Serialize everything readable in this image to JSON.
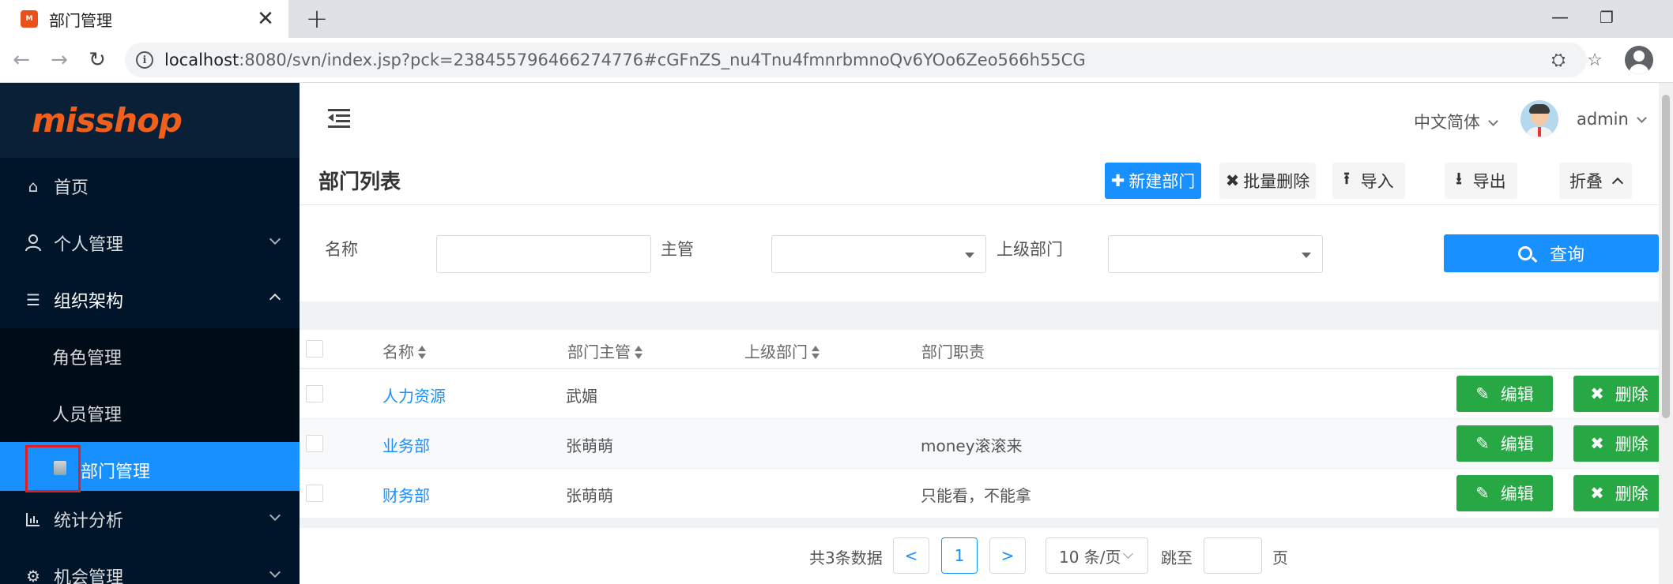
{
  "browser": {
    "tab_title": "部门管理",
    "favicon_label": "misshop",
    "close_glyph": "✕",
    "newtab_glyph": "+",
    "url_host": "localhost",
    "url_rest": ":8080/svn/index.jsp?pck=238455796466274776#cGFnZS_nu4Tnu4fmnrbmnoQv6YOo6Zeo566h55CG",
    "minimize_glyph": "—",
    "restore_glyph": "❐"
  },
  "sidebar": {
    "logo": "misshop",
    "items": [
      {
        "label": "首页",
        "icon": "home-icon"
      },
      {
        "label": "个人管理",
        "icon": "user-icon"
      },
      {
        "label": "组织架构",
        "icon": "menu-icon"
      },
      {
        "label": "统计分析",
        "icon": "bar-chart-icon"
      },
      {
        "label": "机会管理",
        "icon": "gear-icon"
      }
    ],
    "submenu": [
      {
        "label": "角色管理"
      },
      {
        "label": "人员管理"
      },
      {
        "label": "部门管理"
      }
    ]
  },
  "header": {
    "language": "中文简体",
    "username": "admin"
  },
  "panel": {
    "title": "部门列表",
    "buttons": {
      "new": "新建部门",
      "batch_delete": "批量删除",
      "import": "导入",
      "export": "导出",
      "fold": "折叠"
    }
  },
  "search": {
    "name_label": "名称",
    "manager_label": "主管",
    "parent_label": "上级部门",
    "button": "查询"
  },
  "table": {
    "columns": [
      "名称",
      "部门主管",
      "上级部门",
      "部门职责"
    ],
    "edit_label": "编辑",
    "delete_label": "删除",
    "rows": [
      {
        "name": "人力资源",
        "manager": "武媚",
        "parent": "",
        "duty": ""
      },
      {
        "name": "业务部",
        "manager": "张萌萌",
        "parent": "",
        "duty": "money滚滚来"
      },
      {
        "name": "财务部",
        "manager": "张萌萌",
        "parent": "",
        "duty": "只能看，不能拿"
      }
    ]
  },
  "pagination": {
    "total": "共3条数据",
    "current_page": "1",
    "page_size": "10 条/页",
    "jump_label": "跳至",
    "page_unit": "页",
    "prev_glyph": "<",
    "next_glyph": ">"
  },
  "colors": {
    "primary": "#1890ff",
    "success": "#28a745",
    "sidebar_bg": "#001529",
    "logo": "#f0601c",
    "highlight_box": "#e02020"
  }
}
